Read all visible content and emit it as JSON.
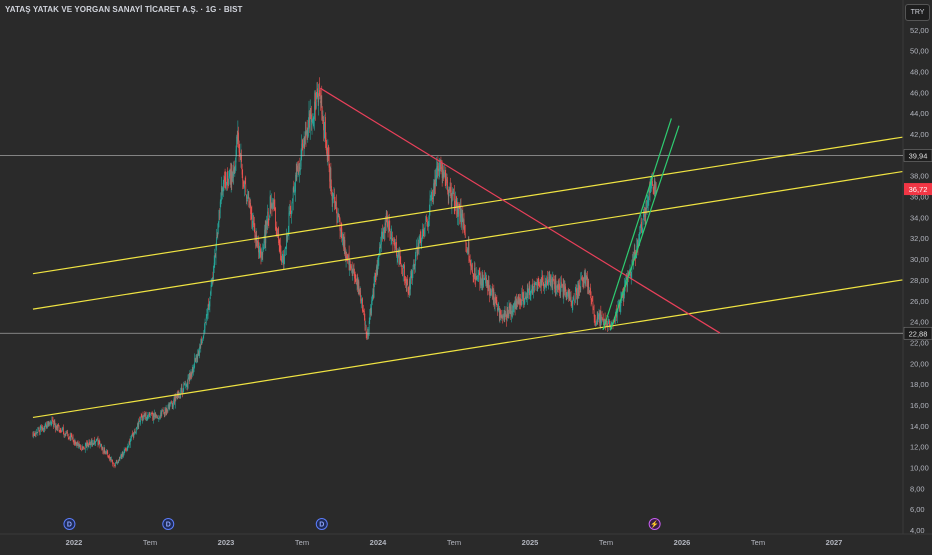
{
  "title": "YATAŞ YATAK VE YORGAN SANAYİ TİCARET A.Ş. · 1G · BIST",
  "currency": "TRY",
  "colors": {
    "background": "#2a2a2a",
    "up_candle": "#26a69a",
    "down_candle": "#ef5350",
    "channel": "#f0e442",
    "trend_down": "#e8405a",
    "trend_up": "#2ecc71",
    "price_label": "#f23645",
    "hline": "#bfbfbf"
  },
  "chart_data": {
    "type": "candlestick",
    "y_axis": {
      "min": 4,
      "max": 54,
      "ticks": [
        "4,00",
        "6,00",
        "8,00",
        "10,00",
        "12,00",
        "14,00",
        "16,00",
        "18,00",
        "20,00",
        "22,00",
        "24,00",
        "26,00",
        "28,00",
        "30,00",
        "32,00",
        "34,00",
        "36,00",
        "38,00",
        "40,00",
        "42,00",
        "44,00",
        "46,00",
        "48,00",
        "50,00",
        "52,00"
      ]
    },
    "x_axis": {
      "ticks": [
        {
          "label": "2022",
          "t": 2022.0
        },
        {
          "label": "Tem",
          "t": 2022.5
        },
        {
          "label": "2023",
          "t": 2023.0
        },
        {
          "label": "Tem",
          "t": 2023.5
        },
        {
          "label": "2024",
          "t": 2024.0
        },
        {
          "label": "Tem",
          "t": 2024.5
        },
        {
          "label": "2025",
          "t": 2025.0
        },
        {
          "label": "Tem",
          "t": 2025.5
        },
        {
          "label": "2026",
          "t": 2026.0
        },
        {
          "label": "Tem",
          "t": 2026.5
        },
        {
          "label": "2027",
          "t": 2027.0
        }
      ]
    },
    "price_path": [
      [
        2021.73,
        13.3
      ],
      [
        2021.85,
        14.3
      ],
      [
        2021.95,
        13.2
      ],
      [
        2022.05,
        11.8
      ],
      [
        2022.15,
        12.6
      ],
      [
        2022.27,
        10.3
      ],
      [
        2022.35,
        12.0
      ],
      [
        2022.45,
        15.0
      ],
      [
        2022.55,
        14.8
      ],
      [
        2022.65,
        16.2
      ],
      [
        2022.75,
        18.2
      ],
      [
        2022.85,
        22.5
      ],
      [
        2022.92,
        29.0
      ],
      [
        2022.97,
        36.5
      ],
      [
        2023.05,
        38.5
      ],
      [
        2023.08,
        42.0
      ],
      [
        2023.12,
        37.0
      ],
      [
        2023.18,
        33.0
      ],
      [
        2023.23,
        30.0
      ],
      [
        2023.3,
        36.0
      ],
      [
        2023.37,
        29.5
      ],
      [
        2023.45,
        37.0
      ],
      [
        2023.55,
        43.5
      ],
      [
        2023.62,
        46.2
      ],
      [
        2023.7,
        36.0
      ],
      [
        2023.8,
        30.0
      ],
      [
        2023.88,
        27.0
      ],
      [
        2023.93,
        22.5
      ],
      [
        2023.98,
        28.0
      ],
      [
        2024.05,
        34.0
      ],
      [
        2024.12,
        31.0
      ],
      [
        2024.2,
        27.0
      ],
      [
        2024.27,
        31.5
      ],
      [
        2024.33,
        34.0
      ],
      [
        2024.4,
        39.5
      ],
      [
        2024.48,
        36.0
      ],
      [
        2024.55,
        34.0
      ],
      [
        2024.62,
        29.0
      ],
      [
        2024.72,
        27.5
      ],
      [
        2024.82,
        24.3
      ],
      [
        2024.9,
        25.5
      ],
      [
        2025.0,
        27.0
      ],
      [
        2025.1,
        28.0
      ],
      [
        2025.18,
        27.5
      ],
      [
        2025.28,
        26.0
      ],
      [
        2025.37,
        28.5
      ],
      [
        2025.43,
        24.0
      ],
      [
        2025.48,
        24.5
      ],
      [
        2025.53,
        23.5
      ],
      [
        2025.6,
        26.0
      ],
      [
        2025.68,
        30.0
      ],
      [
        2025.75,
        34.0
      ],
      [
        2025.8,
        37.5
      ],
      [
        2025.83,
        36.72
      ]
    ],
    "horizontal_levels": [
      {
        "label": "39,94",
        "value": 39.94
      },
      {
        "label": "22,88",
        "value": 22.88
      }
    ],
    "last_price": {
      "label": "36,72",
      "value": 36.72
    },
    "trend_lines": [
      {
        "name": "channel-upper",
        "kind": "channel",
        "from": [
          2021.73,
          28.6
        ],
        "to": [
          2027.45,
          41.7
        ]
      },
      {
        "name": "channel-middle",
        "kind": "channel",
        "from": [
          2021.73,
          25.2
        ],
        "to": [
          2027.45,
          38.4
        ]
      },
      {
        "name": "channel-lower",
        "kind": "channel",
        "from": [
          2021.73,
          14.8
        ],
        "to": [
          2027.45,
          28.0
        ]
      },
      {
        "name": "descending-line",
        "kind": "trend_down",
        "from": [
          2023.62,
          46.4
        ],
        "to": [
          2026.25,
          22.9
        ]
      },
      {
        "name": "ascending-line-left",
        "kind": "trend_up",
        "from": [
          2025.48,
          23.2
        ],
        "to": [
          2025.93,
          43.5
        ]
      },
      {
        "name": "ascending-line-right",
        "kind": "trend_up",
        "from": [
          2025.53,
          23.2
        ],
        "to": [
          2025.98,
          42.8
        ]
      }
    ],
    "event_markers": [
      {
        "label": "D",
        "t": 2021.97,
        "kind": "dividend"
      },
      {
        "label": "D",
        "t": 2022.62,
        "kind": "dividend"
      },
      {
        "label": "D",
        "t": 2023.63,
        "kind": "dividend"
      },
      {
        "label": "⚡",
        "t": 2025.82,
        "kind": "event"
      }
    ]
  }
}
